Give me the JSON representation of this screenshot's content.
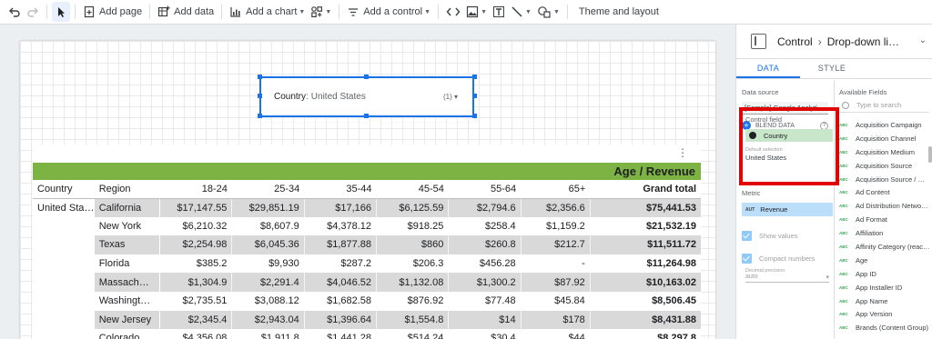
{
  "toolbar": {
    "add_page": "Add page",
    "add_data": "Add data",
    "add_chart": "Add a chart",
    "add_control": "Add a control",
    "theme_layout": "Theme and layout"
  },
  "control": {
    "field": "Country",
    "separator": ":",
    "value": "United States",
    "count": "(1)"
  },
  "table": {
    "title": "Age / Revenue",
    "columns": [
      "Country",
      "Region",
      "18-24",
      "25-34",
      "35-44",
      "45-54",
      "55-64",
      "65+",
      "Grand total"
    ],
    "country": "United Sta…",
    "rows": [
      [
        "California",
        "$17,147.55",
        "$29,851.19",
        "$17,166",
        "$6,125.59",
        "$2,794.6",
        "$2,356.6",
        "$75,441.53"
      ],
      [
        "New York",
        "$6,210.32",
        "$8,607.9",
        "$4,378.12",
        "$918.25",
        "$258.4",
        "$1,159.2",
        "$21,532.19"
      ],
      [
        "Texas",
        "$2,254.98",
        "$6,045.36",
        "$1,877.88",
        "$860",
        "$260.8",
        "$212.7",
        "$11,511.72"
      ],
      [
        "Florida",
        "$385.2",
        "$9,930",
        "$287.2",
        "$206.3",
        "$456.28",
        "-",
        "$11,264.98"
      ],
      [
        "Massach…",
        "$1,304.9",
        "$2,291.4",
        "$4,046.52",
        "$1,132.08",
        "$1,300.2",
        "$87.92",
        "$10,163.02"
      ],
      [
        "Washingt…",
        "$2,735.51",
        "$3,088.12",
        "$1,682.58",
        "$876.92",
        "$77.48",
        "$45.84",
        "$8,506.45"
      ],
      [
        "New Jersey",
        "$2,345.4",
        "$2,943.04",
        "$1,396.64",
        "$1,554.8",
        "$14",
        "$178",
        "$8,431.88"
      ],
      [
        "Colorado",
        "$4,356.08",
        "$1,911.8",
        "$1,441.28",
        "$514.24",
        "$30.4",
        "$44",
        "$8,297.8"
      ]
    ]
  },
  "panel": {
    "crumb_root": "Control",
    "crumb_current": "Drop-down li…",
    "tab_data": "DATA",
    "tab_style": "STYLE",
    "data_source_label": "Data source",
    "data_source_value": "[Sample] Google Analyti…",
    "blend_label": "BLEND DATA",
    "help": "?",
    "control_field_label": "Control field",
    "control_field_value": "Country",
    "default_selection_label": "Default selection",
    "default_selection_value": "United States",
    "metric_label": "Metric",
    "metric_type": "AUT",
    "metric_value": "Revenue",
    "show_values": "Show values",
    "compact_numbers": "Compact numbers",
    "decimal_precision_label": "Decimal precision",
    "decimal_precision_value": "auto",
    "available_fields_label": "Available Fields",
    "search_placeholder": "Type to search",
    "field_type": "ABC",
    "fields": [
      "Acquisition Campaign",
      "Acquisition Channel",
      "Acquisition Medium",
      "Acquisition Source",
      "Acquisition Source / …",
      "Ad Content",
      "Ad Distribution Netwo…",
      "Ad Format",
      "Affiliation",
      "Affinity Category (reac…",
      "Age",
      "App ID",
      "App Installer ID",
      "App Name",
      "App Version",
      "Brands (Content Group)"
    ]
  },
  "colors": {
    "accent": "#1a73e8",
    "banner": "#7cb342",
    "highlight_box": "#e00000"
  }
}
